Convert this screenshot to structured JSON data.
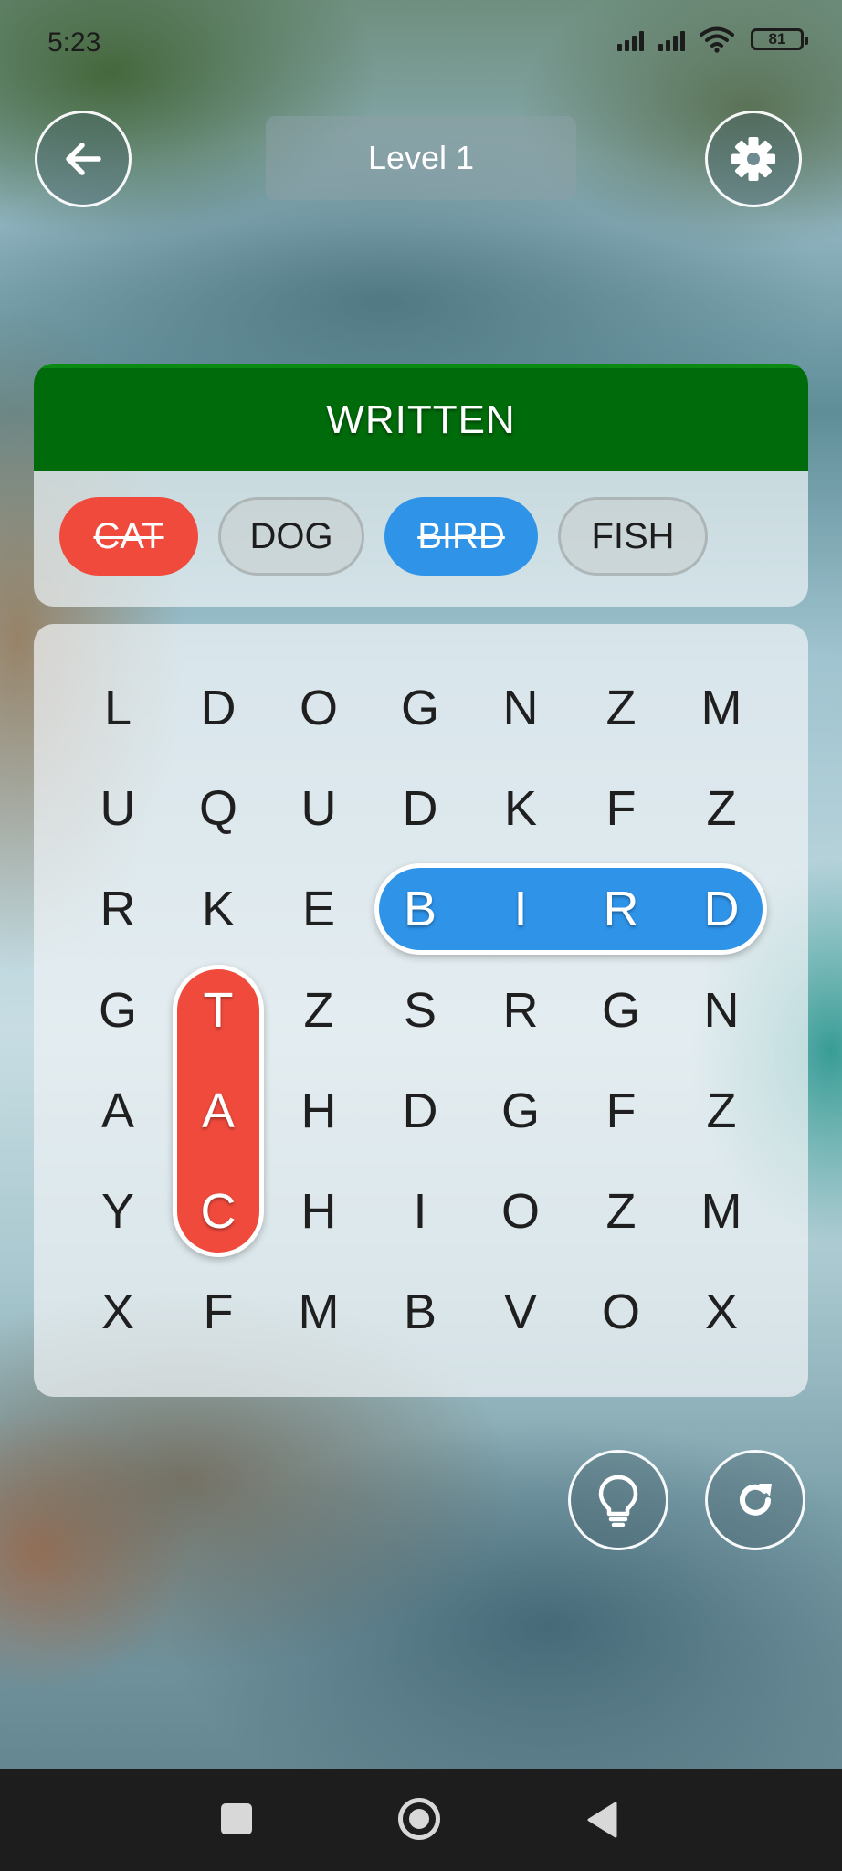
{
  "status": {
    "time": "5:23",
    "battery": "81"
  },
  "header": {
    "level_title": "Level 1"
  },
  "category": {
    "title": "WRITTEN"
  },
  "words": [
    {
      "label": "CAT",
      "found": true,
      "color": "#ef4a3c"
    },
    {
      "label": "DOG",
      "found": false,
      "color": ""
    },
    {
      "label": "BIRD",
      "found": true,
      "color": "#2f93e8"
    },
    {
      "label": "FISH",
      "found": false,
      "color": ""
    }
  ],
  "grid": [
    [
      "L",
      "D",
      "O",
      "G",
      "N",
      "Z",
      "M"
    ],
    [
      "U",
      "Q",
      "U",
      "D",
      "K",
      "F",
      "Z"
    ],
    [
      "R",
      "K",
      "E",
      "B",
      "I",
      "R",
      "D"
    ],
    [
      "G",
      "T",
      "Z",
      "S",
      "R",
      "G",
      "N"
    ],
    [
      "A",
      "A",
      "H",
      "D",
      "G",
      "F",
      "Z"
    ],
    [
      "Y",
      "C",
      "H",
      "I",
      "O",
      "Z",
      "M"
    ],
    [
      "X",
      "F",
      "M",
      "B",
      "V",
      "O",
      "X"
    ]
  ],
  "found_highlights": [
    {
      "word": "CAT",
      "color": "#ef4a3c",
      "cells": [
        [
          5,
          1
        ],
        [
          4,
          1
        ],
        [
          3,
          1
        ]
      ]
    },
    {
      "word": "BIRD",
      "color": "#2f93e8",
      "cells": [
        [
          2,
          3
        ],
        [
          2,
          4
        ],
        [
          2,
          5
        ],
        [
          2,
          6
        ]
      ]
    }
  ],
  "icons": {
    "back": "arrow-left-icon",
    "settings": "gear-icon",
    "hint": "lightbulb-icon",
    "restart": "refresh-icon",
    "nav_recents": "square-icon",
    "nav_home": "circle-icon",
    "nav_back": "triangle-back-icon"
  }
}
